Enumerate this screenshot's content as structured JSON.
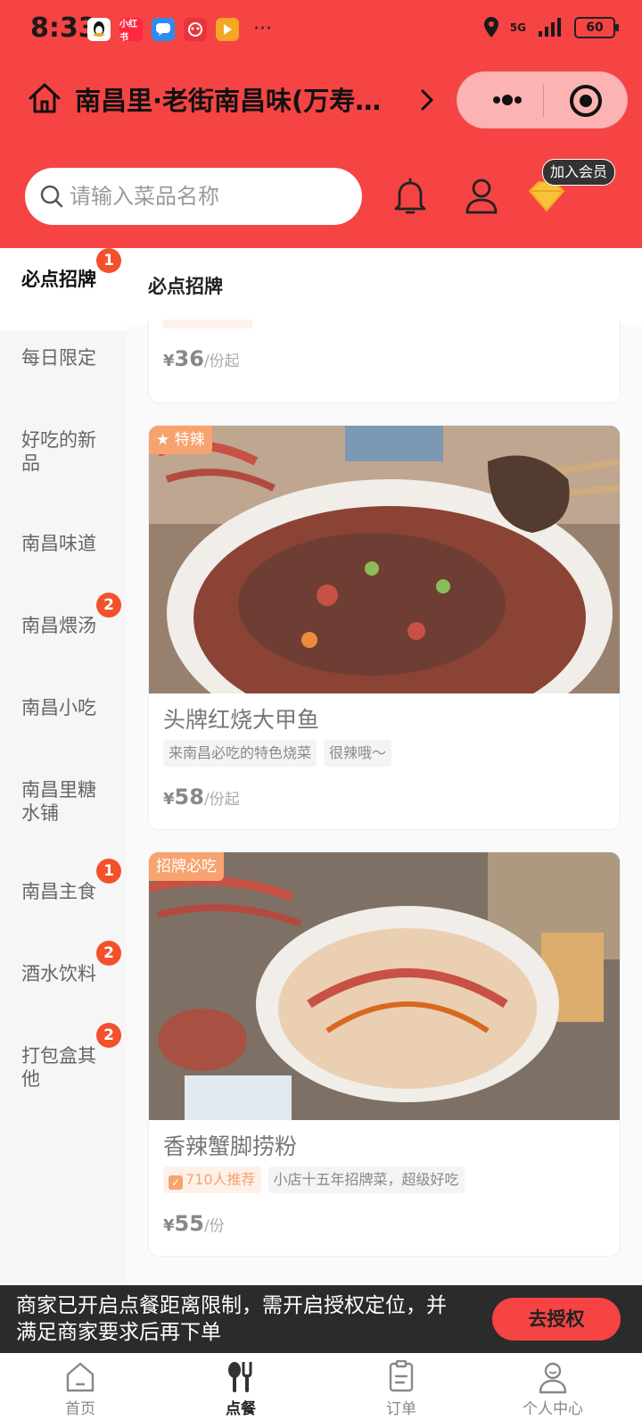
{
  "status_bar": {
    "time": "8:33",
    "apps": [
      {
        "icon": "qq-icon",
        "color": "#ffffff",
        "label": ""
      },
      {
        "icon": "xiaohongshu-icon",
        "color": "#ff2741",
        "label": "小红书"
      },
      {
        "icon": "message-icon",
        "color": "#2d8cf0",
        "label": ""
      },
      {
        "icon": "game-icon",
        "color": "#e8343b",
        "label": ""
      },
      {
        "icon": "video-icon",
        "color": "#f5a623",
        "label": ""
      }
    ],
    "more": "···",
    "network": "5G",
    "battery": "60"
  },
  "header": {
    "store_name": "南昌里·老街南昌味(万寿…",
    "search_placeholder": "请输入菜品名称",
    "member_tip": "加入会员"
  },
  "sidebar": {
    "categories": [
      {
        "label": "必点招牌",
        "badge": "1",
        "active": true
      },
      {
        "label": "每日限定",
        "badge": "",
        "active": false
      },
      {
        "label": "好吃的新品",
        "badge": "",
        "active": false
      },
      {
        "label": "南昌味道",
        "badge": "",
        "active": false
      },
      {
        "label": "南昌煨汤",
        "badge": "2",
        "active": false
      },
      {
        "label": "南昌小吃",
        "badge": "",
        "active": false
      },
      {
        "label": "南昌里糖水铺",
        "badge": "",
        "active": false
      },
      {
        "label": "南昌主食",
        "badge": "1",
        "active": false
      },
      {
        "label": "酒水饮料",
        "badge": "2",
        "active": false
      },
      {
        "label": "打包盒其他",
        "badge": "2",
        "active": false
      }
    ]
  },
  "main": {
    "section_title": "必点招牌",
    "items": [
      {
        "price": "36",
        "unit": "/份起"
      },
      {
        "tag": "★ 特辣",
        "name": "头牌红烧大甲鱼",
        "chips": [
          "来南昌必吃的特色烧菜",
          "很辣哦～"
        ],
        "price": "58",
        "unit": "/份起"
      },
      {
        "tag": "招牌必吃",
        "name": "香辣蟹脚捞粉",
        "recommend": "710人推荐",
        "chips": [
          "小店十五年招牌菜，超级好吃"
        ],
        "price": "55",
        "unit": "/份"
      }
    ],
    "currency": "¥"
  },
  "banner": {
    "text": "商家已开启点餐距离限制，需开启授权定位，并满足商家要求后再下单",
    "button": "去授权"
  },
  "tabbar": {
    "tabs": [
      {
        "label": "首页",
        "icon": "home-tab-icon"
      },
      {
        "label": "点餐",
        "icon": "order-food-icon"
      },
      {
        "label": "订单",
        "icon": "order-list-icon"
      },
      {
        "label": "个人中心",
        "icon": "profile-icon"
      }
    ],
    "active": 1
  },
  "colors": {
    "brand": "#f64343",
    "badge": "#f2512c",
    "tag": "#f7a36f"
  }
}
